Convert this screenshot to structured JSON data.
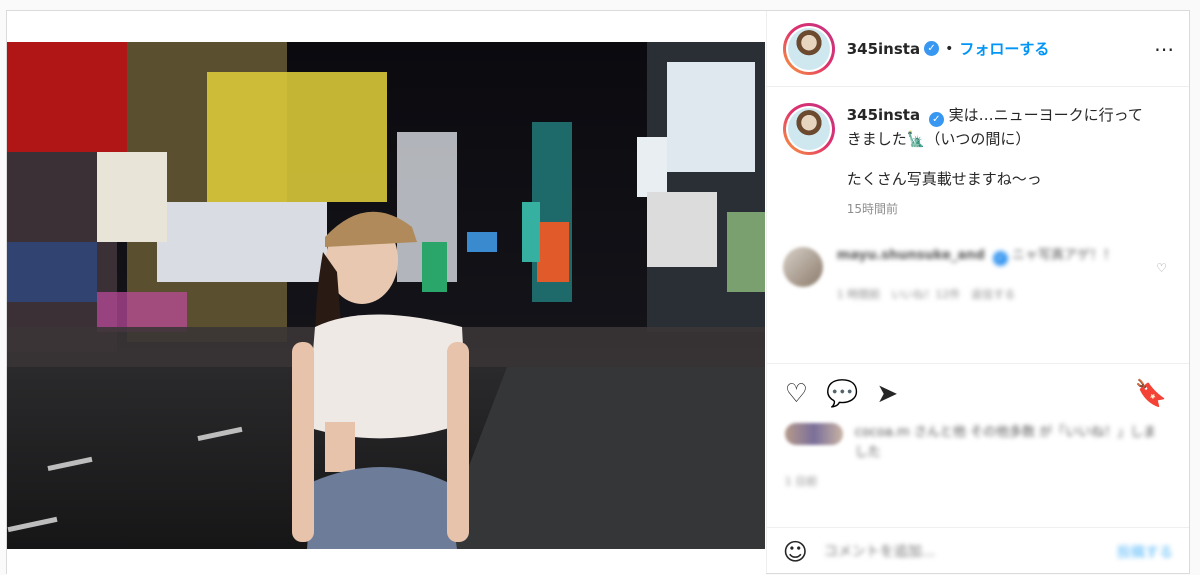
{
  "post": {
    "username": "345insta",
    "verified_icon": "verified-badge-icon",
    "separator": "•",
    "follow_label": "フォローする",
    "more_label": "⋯"
  },
  "caption": {
    "username": "345insta",
    "line1": "実は…ニューヨークに行ってきました🗽（いつの間に）",
    "line2": "たくさん写真載せますね〜っ",
    "time": "15時間前"
  },
  "comment": {
    "username": "mayu.shunsuke_and",
    "text": "ニャ写真アゲ！！",
    "meta": "1 時間前　いいね！12件　返信する",
    "like_icon": "♡"
  },
  "actions": {
    "like": "♡",
    "comment": "💬",
    "share": "➤",
    "bookmark": "🔖"
  },
  "likes": {
    "text": "cocoa.m さんと他 その他多数 が「いいね！」しました"
  },
  "ago": "1 日前",
  "add_comment": {
    "emoji": "☺",
    "placeholder": "コメントを追加...",
    "post_label": "投稿する"
  },
  "colors": {
    "accent": "#0095f6",
    "verified": "#3897f0",
    "border": "#dbdbdb"
  }
}
